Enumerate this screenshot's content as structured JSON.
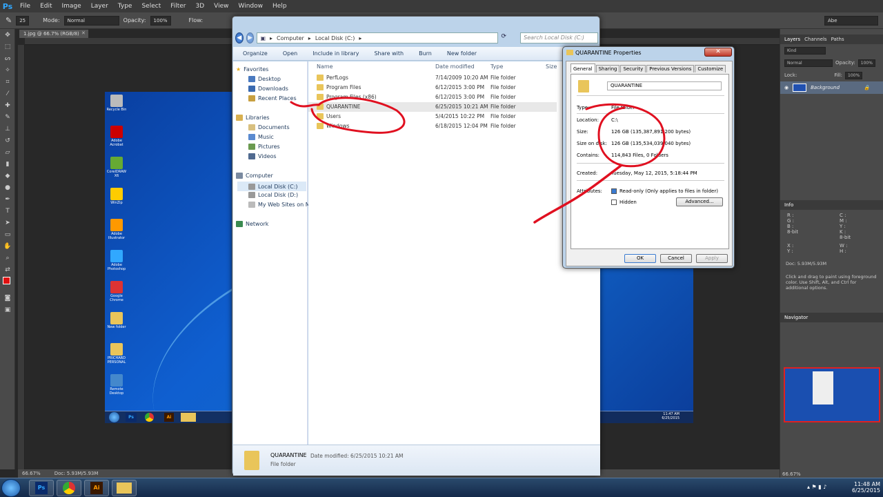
{
  "ps": {
    "logo": "Ps",
    "menus": [
      "File",
      "Edit",
      "Image",
      "Layer",
      "Type",
      "Select",
      "Filter",
      "3D",
      "View",
      "Window",
      "Help"
    ],
    "options": {
      "brush_size": "25",
      "mode_label": "Mode:",
      "mode_value": "Normal",
      "opacity_label": "Opacity:",
      "opacity_value": "100%",
      "flow_label": "Flow:"
    },
    "workspace": "Abe",
    "doc_tab": "1.jpg @ 66.7% (RGB/8)",
    "status": {
      "zoom": "66.67%",
      "doc": "Doc: 5.93M/5.93M"
    },
    "panels": {
      "layers_tabs": [
        "Layers",
        "Channels",
        "Paths"
      ],
      "kind": "Kind",
      "blend": "Normal",
      "opacity_label": "Opacity:",
      "opacity_value": "100%",
      "lock_label": "Lock:",
      "fill_label": "Fill:",
      "fill_value": "100%",
      "layer_name": "Background",
      "info_title": "Info",
      "info": {
        "r": "R :",
        "g": "G :",
        "b": "B :",
        "c": "C :",
        "m": "M :",
        "y": "Y :",
        "k": "K :",
        "bit1": "8-bit",
        "bit2": "8-bit",
        "x": "X :",
        "yy": "Y :",
        "w": "W :",
        "h": "H :",
        "doc": "Doc: 5.93M/5.93M",
        "hint": "Click and drag to paint using foreground color.  Use Shift, Alt, and Ctrl for additional options."
      },
      "navigator_title": "Navigator",
      "navigator_zoom": "66.67%"
    }
  },
  "explorer": {
    "address": [
      "Computer",
      "Local Disk (C:)"
    ],
    "search_placeholder": "Search Local Disk (C:)",
    "commands": [
      "Organize",
      "Open",
      "Include in library",
      "Share with",
      "Burn",
      "New folder"
    ],
    "nav": {
      "favorites": "Favorites",
      "desktop": "Desktop",
      "downloads": "Downloads",
      "recent": "Recent Places",
      "libraries": "Libraries",
      "documents": "Documents",
      "music": "Music",
      "pictures": "Pictures",
      "videos": "Videos",
      "computer": "Computer",
      "c": "Local Disk (C:)",
      "d": "Local Disk (D:)",
      "web": "My Web Sites on MS",
      "network": "Network"
    },
    "columns": {
      "name": "Name",
      "date": "Date modified",
      "type": "Type",
      "size": "Size"
    },
    "files": [
      {
        "name": "PerfLogs",
        "date": "7/14/2009 10:20 AM",
        "type": "File folder"
      },
      {
        "name": "Program Files",
        "date": "6/12/2015 3:00 PM",
        "type": "File folder"
      },
      {
        "name": "Program Files (x86)",
        "date": "6/12/2015 3:00 PM",
        "type": "File folder"
      },
      {
        "name": "QUARANTINE",
        "date": "6/25/2015 10:21 AM",
        "type": "File folder"
      },
      {
        "name": "Users",
        "date": "5/4/2015 10:22 PM",
        "type": "File folder"
      },
      {
        "name": "Windows",
        "date": "6/18/2015 12:04 PM",
        "type": "File folder"
      }
    ],
    "details": {
      "name": "QUARANTINE",
      "modified": "Date modified: 6/25/2015 10:21 AM",
      "type": "File folder"
    }
  },
  "props": {
    "title": "QUARANTINE Properties",
    "tabs": [
      "General",
      "Sharing",
      "Security",
      "Previous Versions",
      "Customize"
    ],
    "folder_name": "QUARANTINE",
    "type_label": "Type:",
    "type_value": "File folder",
    "location_label": "Location:",
    "location_value": "C:\\",
    "size_label": "Size:",
    "size_value": "126 GB (135,387,891,200 bytes)",
    "ondisk_label": "Size on disk:",
    "ondisk_value": "126 GB (135,534,039,040 bytes)",
    "contains_label": "Contains:",
    "contains_value": "114,843 Files, 0 Folders",
    "created_label": "Created:",
    "created_value": "Tuesday, May 12, 2015, 5:18:44 PM",
    "attributes_label": "Attributes:",
    "readonly": "Read-only (Only applies to files in folder)",
    "hidden": "Hidden",
    "advanced": "Advanced...",
    "ok": "OK",
    "cancel": "Cancel",
    "apply": "Apply"
  },
  "inner_desktop": {
    "icons": [
      "Recycle Bin",
      "Adobe Acrobat",
      "CorelDRAW X6",
      "WinZip",
      "Adobe Illustrator",
      "Adobe Photoshop",
      "Google Chrome",
      "New folder",
      "PRICHARD PERSONAL",
      "Remote Desktop"
    ],
    "clock_time": "11:47 AM",
    "clock_date": "6/25/2015"
  },
  "taskbar": {
    "time": "11:48 AM",
    "date": "6/25/2015"
  },
  "colors": {
    "annotation": "#e01020",
    "ps_bg": "#282828",
    "explorer_frame": "#bcd3ea"
  }
}
